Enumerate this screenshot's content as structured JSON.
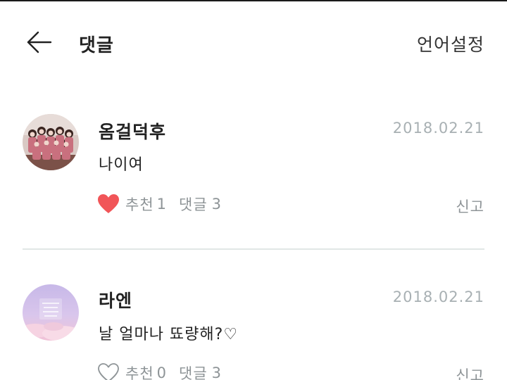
{
  "header": {
    "title": "댓글",
    "language_settings_label": "언어설정"
  },
  "comments": [
    {
      "author": "옴걸덕후",
      "date": "2018.02.21",
      "text": "나이여",
      "liked": true,
      "like_label": "추천",
      "like_count": "1",
      "reply_label": "댓글",
      "reply_count": "3",
      "report_label": "신고"
    },
    {
      "author": "라엔",
      "date": "2018.02.21",
      "text": "날 얼마나 뚀량해?♡",
      "liked": false,
      "like_label": "추천",
      "like_count": "0",
      "reply_label": "댓글",
      "reply_count": "3",
      "report_label": "신고"
    }
  ],
  "icons": {
    "back": "arrow-left-icon",
    "like_filled": "heart-filled-icon",
    "like_outline": "heart-outline-icon"
  },
  "colors": {
    "heart_filled": "#f15558",
    "secondary_text": "#8e9497",
    "date_text": "#a8b0b3",
    "divider": "#e1e7e6"
  }
}
